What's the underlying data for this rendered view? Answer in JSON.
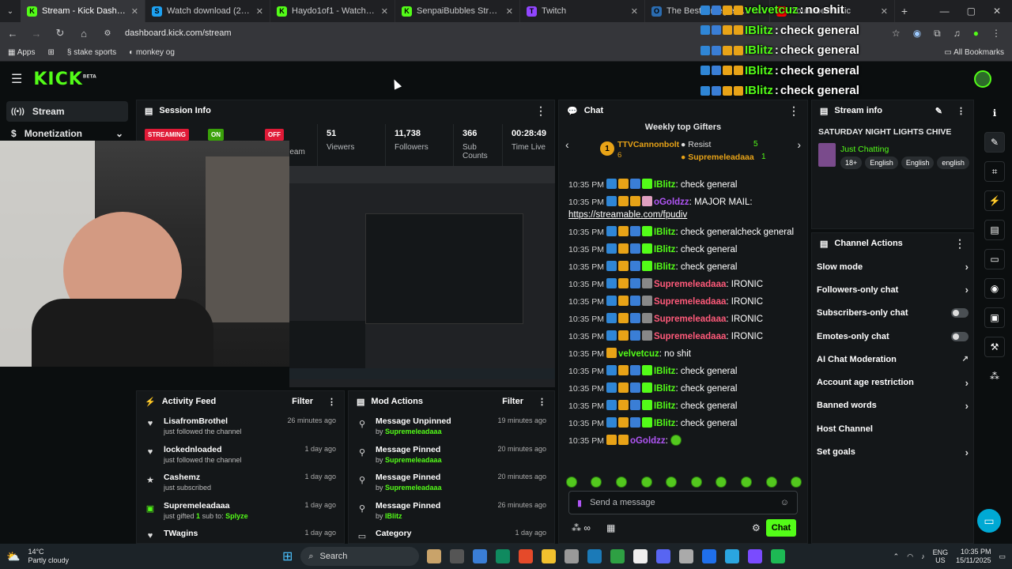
{
  "browser": {
    "tabs": [
      {
        "title": "Stream - Kick Dashboard",
        "icon_letter": "K",
        "icon_color": "#53fc18",
        "active": true
      },
      {
        "title": "Watch download (2) | Streamab",
        "icon_letter": "S",
        "icon_color": "#1da1f2",
        "active": false
      },
      {
        "title": "Haydo1of1 - Watch the VOD o",
        "icon_letter": "K",
        "icon_color": "#53fc18",
        "active": false
      },
      {
        "title": "SenpaiBubbles Stream - Watch",
        "icon_letter": "K",
        "icon_color": "#53fc18",
        "active": false
      },
      {
        "title": "Twitch",
        "icon_letter": "T",
        "icon_color": "#9146ff",
        "active": false
      },
      {
        "title": "The Best Omegle Alternatives",
        "icon_letter": "O",
        "icon_color": "#2b6cb0",
        "active": false
      },
      {
        "title": "YouTube Music",
        "icon_letter": "Y",
        "icon_color": "#ff0000",
        "active": false
      }
    ],
    "url": "dashboard.kick.com/stream",
    "bookmarks": [
      "Apps",
      "stake sports",
      "monkey og"
    ],
    "all_bookmarks": "All Bookmarks"
  },
  "header": {
    "logo": "KICK",
    "logo_sup": "BETA"
  },
  "leftnav": [
    {
      "label": "Stream",
      "icon": "stream-icon",
      "active": true
    },
    {
      "label": "Monetization",
      "icon": "dollar-icon",
      "active": false
    }
  ],
  "session": {
    "title": "Session Info",
    "streaming_label": "STREAMING",
    "on_label": "ON",
    "off_label": "OFF",
    "stream_label": "ream",
    "stats": [
      {
        "value": "51",
        "label": "Viewers"
      },
      {
        "value": "11,738",
        "label": "Followers"
      },
      {
        "value": "366",
        "label": "Sub Counts"
      },
      {
        "value": "00:28:49",
        "label": "Time Live"
      }
    ]
  },
  "activity": {
    "title": "Activity Feed",
    "filter": "Filter",
    "items": [
      {
        "icon": "heart-icon",
        "user": "LisafromBrothel",
        "text": "just followed the channel",
        "time": "26 minutes ago"
      },
      {
        "icon": "heart-icon",
        "user": "lockednloaded",
        "text": "just followed the channel",
        "time": "1 day ago"
      },
      {
        "icon": "star-icon",
        "user": "Cashemz",
        "text": "just subscribed",
        "time": "1 day ago"
      },
      {
        "icon": "gift-icon",
        "user": "Supremeleadaaa",
        "text": "just gifted",
        "count": "1",
        "text2": "sub to:",
        "target": "Splyze",
        "time": "1 day ago"
      },
      {
        "icon": "heart-icon",
        "user": "TWagins",
        "text": "",
        "time": "1 day ago"
      }
    ]
  },
  "mods": {
    "title": "Mod Actions",
    "filter": "Filter",
    "items": [
      {
        "icon": "unpin-icon",
        "action": "Message Unpinned",
        "by": "by",
        "user": "Supremeleadaaa",
        "time": "19 minutes ago"
      },
      {
        "icon": "pin-icon",
        "action": "Message Pinned",
        "by": "by",
        "user": "Supremeleadaaa",
        "time": "20 minutes ago"
      },
      {
        "icon": "pin-icon",
        "action": "Message Pinned",
        "by": "by",
        "user": "Supremeleadaaa",
        "time": "20 minutes ago"
      },
      {
        "icon": "pin-icon",
        "action": "Message Pinned",
        "by": "by",
        "user": "IBlitz",
        "time": "26 minutes ago"
      },
      {
        "icon": "category-icon",
        "action": "Category",
        "by": "",
        "user": "",
        "time": "1 day ago"
      }
    ]
  },
  "chat": {
    "title": "Chat",
    "gifters_title": "Weekly top Gifters",
    "top_gifter": {
      "name": "TTVCannonbolt",
      "count": "6"
    },
    "gifter2": {
      "name": "Resist",
      "count": "5"
    },
    "gifter3": {
      "name": "Supremeleadaaa",
      "count": "1"
    },
    "messages": [
      {
        "time": "10:35 PM",
        "user": "IBlitz",
        "color": "#53fc18",
        "badges": [
          "b1",
          "b2",
          "b3",
          "b4"
        ],
        "text": "check general"
      },
      {
        "time": "10:35 PM",
        "user": "oGoldzz",
        "color": "#b055f5",
        "badges": [
          "b1",
          "b2",
          "b2",
          "b6"
        ],
        "text": "MAJOR MAIL:",
        "link": "https://streamable.com/fpudiv"
      },
      {
        "time": "10:35 PM",
        "user": "IBlitz",
        "color": "#53fc18",
        "badges": [
          "b1",
          "b2",
          "b3",
          "b4"
        ],
        "text": "check generalcheck general"
      },
      {
        "time": "10:35 PM",
        "user": "IBlitz",
        "color": "#53fc18",
        "badges": [
          "b1",
          "b2",
          "b3",
          "b4"
        ],
        "text": "check general"
      },
      {
        "time": "10:35 PM",
        "user": "IBlitz",
        "color": "#53fc18",
        "badges": [
          "b1",
          "b2",
          "b3",
          "b4"
        ],
        "text": "check general"
      },
      {
        "time": "10:35 PM",
        "user": "Supremeleadaaa",
        "color": "#ff5a7a",
        "badges": [
          "b1",
          "b2",
          "b3",
          "b5"
        ],
        "text": "IRONIC"
      },
      {
        "time": "10:35 PM",
        "user": "Supremeleadaaa",
        "color": "#ff5a7a",
        "badges": [
          "b1",
          "b2",
          "b3",
          "b5"
        ],
        "text": "IRONIC"
      },
      {
        "time": "10:35 PM",
        "user": "Supremeleadaaa",
        "color": "#ff5a7a",
        "badges": [
          "b1",
          "b2",
          "b3",
          "b5"
        ],
        "text": "IRONIC"
      },
      {
        "time": "10:35 PM",
        "user": "Supremeleadaaa",
        "color": "#ff5a7a",
        "badges": [
          "b1",
          "b2",
          "b3",
          "b5"
        ],
        "text": "IRONIC"
      },
      {
        "time": "10:35 PM",
        "user": "velvetcuz",
        "color": "#53fc18",
        "badges": [
          "b2"
        ],
        "text": "no shit"
      },
      {
        "time": "10:35 PM",
        "user": "IBlitz",
        "color": "#53fc18",
        "badges": [
          "b1",
          "b2",
          "b3",
          "b4"
        ],
        "text": "check general"
      },
      {
        "time": "10:35 PM",
        "user": "IBlitz",
        "color": "#53fc18",
        "badges": [
          "b1",
          "b2",
          "b3",
          "b4"
        ],
        "text": "check general"
      },
      {
        "time": "10:35 PM",
        "user": "IBlitz",
        "color": "#53fc18",
        "badges": [
          "b1",
          "b2",
          "b3",
          "b4"
        ],
        "text": "check general"
      },
      {
        "time": "10:35 PM",
        "user": "IBlitz",
        "color": "#53fc18",
        "badges": [
          "b1",
          "b2",
          "b3",
          "b4"
        ],
        "text": "check general"
      },
      {
        "time": "10:35 PM",
        "user": "oGoldzz",
        "color": "#b055f5",
        "badges": [
          "b2",
          "b2"
        ],
        "text": ""
      }
    ],
    "placeholder": "Send a message",
    "send_label": "Chat"
  },
  "stream_info": {
    "title": "Stream info",
    "stream_title": "SATURDAY NIGHT LIGHTS CHIVE",
    "category": "Just Chatting",
    "tags": [
      "18+",
      "English",
      "English",
      "english"
    ]
  },
  "channel_actions": {
    "title": "Channel Actions",
    "items": [
      {
        "label": "Slow mode",
        "control": "arrow"
      },
      {
        "label": "Followers-only chat",
        "control": "arrow"
      },
      {
        "label": "Subscribers-only chat",
        "control": "toggle"
      },
      {
        "label": "Emotes-only chat",
        "control": "toggle"
      },
      {
        "label": "AI Chat Moderation",
        "control": "external"
      },
      {
        "label": "Account age restriction",
        "control": "arrow"
      },
      {
        "label": "Banned words",
        "control": "arrow"
      },
      {
        "label": "Host Channel",
        "control": "none"
      },
      {
        "label": "Set goals",
        "control": "arrow"
      }
    ]
  },
  "overlay": {
    "lines": [
      {
        "user": "velvetcuz",
        "text": "no shit"
      },
      {
        "user": "IBlitz",
        "text": "check general"
      },
      {
        "user": "IBlitz",
        "text": "check general"
      },
      {
        "user": "IBlitz",
        "text": "check general"
      },
      {
        "user": "IBlitz",
        "text": "check general"
      }
    ]
  },
  "taskbar": {
    "weather_temp": "14°C",
    "weather_text": "Partly cloudy",
    "search": "Search",
    "lang": "ENG",
    "region": "US",
    "time": "10:35 PM",
    "date": "15/11/2025"
  }
}
